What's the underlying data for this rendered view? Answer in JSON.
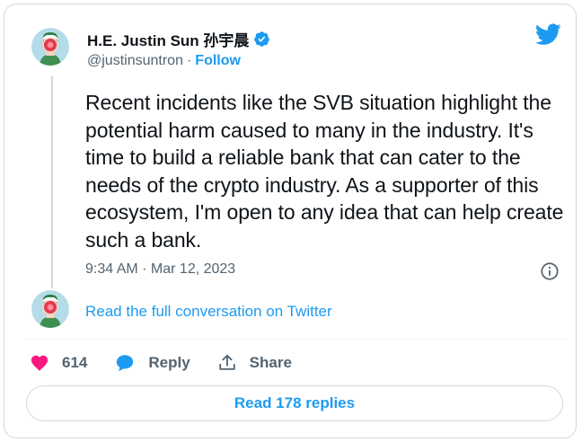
{
  "author": {
    "display_name": "H.E. Justin Sun 孙宇晨",
    "handle": "@justinsuntron",
    "separator": "·",
    "follow_label": "Follow",
    "verified": true
  },
  "tweet": {
    "text": "Recent incidents like the SVB situation highlight the potential harm caused to many in the industry. It's time to build a reliable bank that can cater to the needs of the crypto industry. As a supporter of this ecosystem, I'm open to any idea that can help create such a bank.",
    "timestamp": "9:34 AM · Mar 12, 2023"
  },
  "conversation": {
    "link_label": "Read the full conversation on Twitter"
  },
  "actions": {
    "like_count": "614",
    "reply_label": "Reply",
    "share_label": "Share"
  },
  "replies": {
    "button_label": "Read 178 replies"
  },
  "colors": {
    "accent": "#1d9bf0",
    "like": "#f91880",
    "text": "#0f1419",
    "secondary_text": "#536471",
    "border": "#cfd9de"
  },
  "icons": {
    "twitter": "twitter-bird-icon",
    "verified": "verified-badge-icon",
    "info": "info-icon",
    "like": "heart-icon",
    "reply": "reply-bubble-icon",
    "share": "share-upload-icon"
  }
}
